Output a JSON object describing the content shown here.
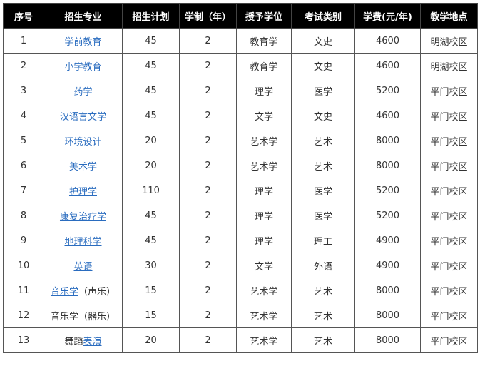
{
  "headers": [
    "序号",
    "招生专业",
    "招生计划",
    "学制（年）",
    "授予学位",
    "考试类别",
    "学费(元/年)",
    "教学地点"
  ],
  "rows": [
    {
      "no": "1",
      "major": [
        {
          "t": "学前教育",
          "link": true
        }
      ],
      "plan": "45",
      "years": "2",
      "degree": "教育学",
      "exam": "文史",
      "fee": "4600",
      "campus": "明湖校区"
    },
    {
      "no": "2",
      "major": [
        {
          "t": "小学教育",
          "link": true
        }
      ],
      "plan": "45",
      "years": "2",
      "degree": "教育学",
      "exam": "文史",
      "fee": "4600",
      "campus": "明湖校区"
    },
    {
      "no": "3",
      "major": [
        {
          "t": "药学",
          "link": true
        }
      ],
      "plan": "45",
      "years": "2",
      "degree": "理学",
      "exam": "医学",
      "fee": "5200",
      "campus": "平门校区"
    },
    {
      "no": "4",
      "major": [
        {
          "t": "汉语言文学",
          "link": true
        }
      ],
      "plan": "45",
      "years": "2",
      "degree": "文学",
      "exam": "文史",
      "fee": "4600",
      "campus": "平门校区"
    },
    {
      "no": "5",
      "major": [
        {
          "t": "环境设计",
          "link": true
        }
      ],
      "plan": "20",
      "years": "2",
      "degree": "艺术学",
      "exam": "艺术",
      "fee": "8000",
      "campus": "平门校区"
    },
    {
      "no": "6",
      "major": [
        {
          "t": "美术学",
          "link": true
        }
      ],
      "plan": "20",
      "years": "2",
      "degree": "艺术学",
      "exam": "艺术",
      "fee": "8000",
      "campus": "平门校区"
    },
    {
      "no": "7",
      "major": [
        {
          "t": "护理学",
          "link": true
        }
      ],
      "plan": "110",
      "years": "2",
      "degree": "理学",
      "exam": "医学",
      "fee": "5200",
      "campus": "平门校区"
    },
    {
      "no": "8",
      "major": [
        {
          "t": "康复治疗学",
          "link": true
        }
      ],
      "plan": "45",
      "years": "2",
      "degree": "理学",
      "exam": "医学",
      "fee": "5200",
      "campus": "平门校区"
    },
    {
      "no": "9",
      "major": [
        {
          "t": "地理科学",
          "link": true
        }
      ],
      "plan": "45",
      "years": "2",
      "degree": "理学",
      "exam": "理工",
      "fee": "4900",
      "campus": "平门校区"
    },
    {
      "no": "10",
      "major": [
        {
          "t": "英语",
          "link": true
        }
      ],
      "plan": "30",
      "years": "2",
      "degree": "文学",
      "exam": "外语",
      "fee": "4900",
      "campus": "平门校区"
    },
    {
      "no": "11",
      "major": [
        {
          "t": "音乐学",
          "link": true
        },
        {
          "t": "（声乐）",
          "link": false
        }
      ],
      "plan": "15",
      "years": "2",
      "degree": "艺术学",
      "exam": "艺术",
      "fee": "8000",
      "campus": "平门校区"
    },
    {
      "no": "12",
      "major": [
        {
          "t": "音乐学（器乐）",
          "link": false
        }
      ],
      "plan": "15",
      "years": "2",
      "degree": "艺术学",
      "exam": "艺术",
      "fee": "8000",
      "campus": "平门校区"
    },
    {
      "no": "13",
      "major": [
        {
          "t": "舞蹈",
          "link": false
        },
        {
          "t": "表演",
          "link": true
        }
      ],
      "plan": "20",
      "years": "2",
      "degree": "艺术学",
      "exam": "艺术",
      "fee": "8000",
      "campus": "平门校区"
    }
  ],
  "colors": {
    "header_bg": "#000000",
    "header_text": "#ffffff",
    "link": "#2a6cbf",
    "border": "#555555"
  }
}
